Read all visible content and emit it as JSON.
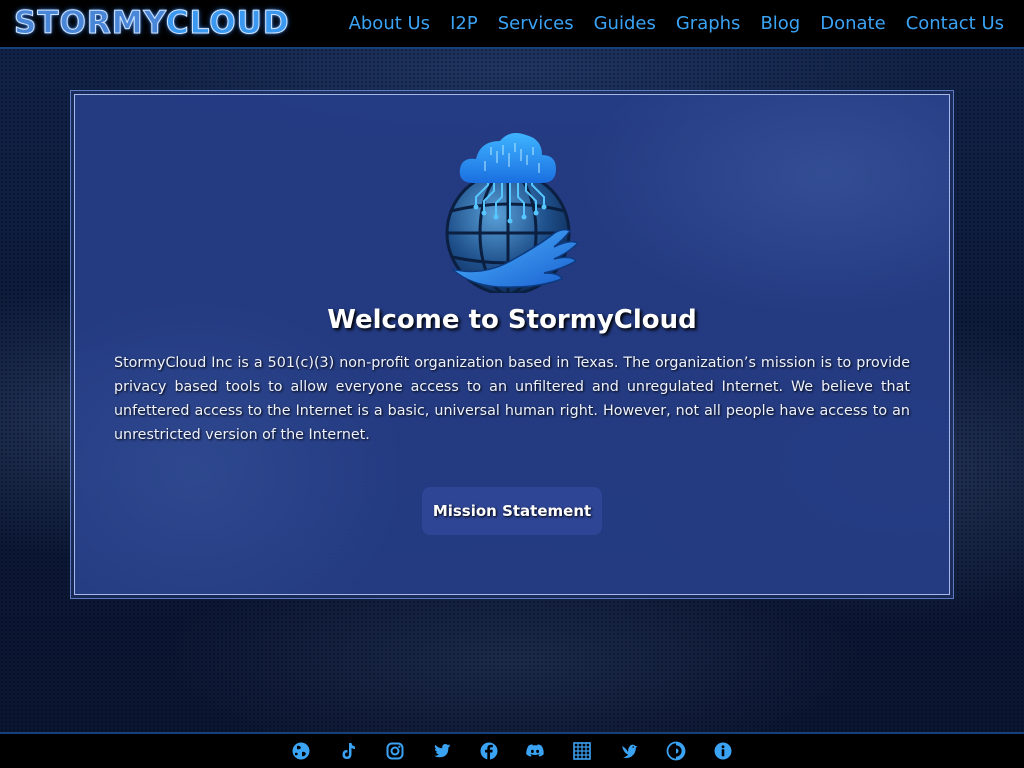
{
  "brand": {
    "logo_part1": "STORMY",
    "logo_part2": "CLOUD"
  },
  "nav": {
    "items": [
      {
        "label": "About Us"
      },
      {
        "label": "I2P"
      },
      {
        "label": "Services"
      },
      {
        "label": "Guides"
      },
      {
        "label": "Graphs"
      },
      {
        "label": "Blog"
      },
      {
        "label": "Donate"
      },
      {
        "label": "Contact Us"
      }
    ]
  },
  "main": {
    "title": "Welcome to StormyCloud",
    "intro": "StormyCloud Inc is a 501(c)(3) non-profit organization based in Texas. The organization’s mission is to provide privacy based tools to allow everyone access to an unfiltered and unregulated Internet. We believe that unfettered access to the Internet is a basic, universal human right. However, not all people have access to an unrestricted version of the Internet.",
    "mission_button": "Mission Statement"
  },
  "footer": {
    "icons": [
      "globe-icon",
      "tiktok-icon",
      "instagram-icon",
      "twitter-icon",
      "facebook-icon",
      "discord-icon",
      "grid-icon",
      "bird-icon",
      "tor-icon",
      "info-icon"
    ]
  },
  "colors": {
    "accent": "#3ba3f4",
    "header_bg": "#000000",
    "card_bg": "#263e87",
    "button_bg": "#2e4494"
  }
}
